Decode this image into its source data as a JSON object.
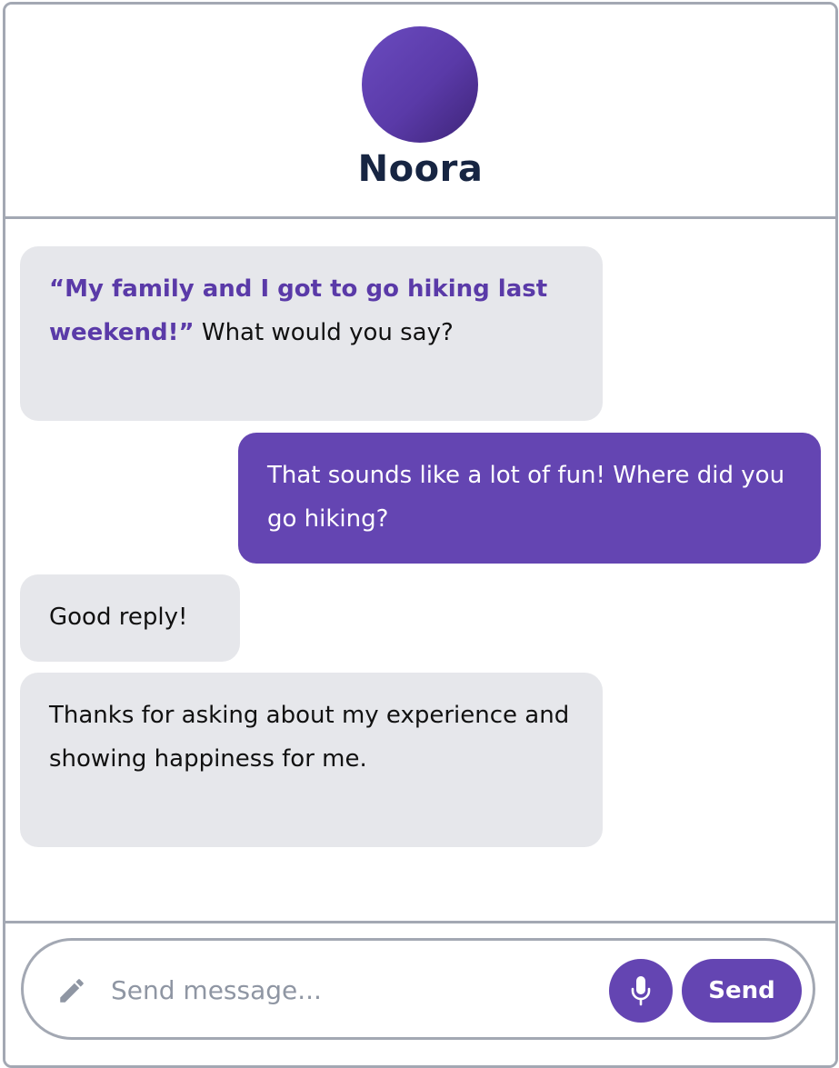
{
  "contact": {
    "name": "Noora",
    "avatar_colors": [
      "#6a4bbf",
      "#3e2478"
    ]
  },
  "messages": [
    {
      "sender": "contact",
      "quote": "“My family and I got to go hiking last weekend!”",
      "text": " What would you say?"
    },
    {
      "sender": "user",
      "text": "That sounds like a lot of fun! Where did you go hiking?"
    },
    {
      "sender": "contact",
      "text": "Good reply!"
    },
    {
      "sender": "contact",
      "text": "Thanks for asking about my experience and showing happiness for me."
    }
  ],
  "composer": {
    "value": "",
    "placeholder": "Send message...",
    "pencil_icon": "pencil-icon",
    "mic_icon": "microphone-icon",
    "send_label": "Send"
  },
  "colors": {
    "accent": "#6445b2",
    "bubble_in": "#e6e7eb",
    "border": "#a3a8b3",
    "name_text": "#172542",
    "quote_text": "#5a3aa8"
  }
}
